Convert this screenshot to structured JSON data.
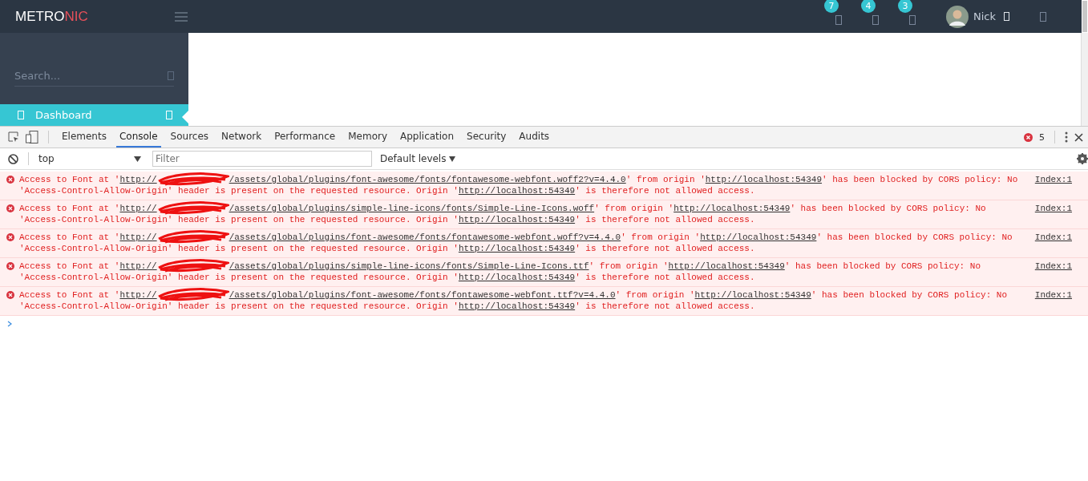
{
  "header": {
    "logo": {
      "main": "METRO",
      "accent": "NIC"
    },
    "badges": [
      "7",
      "4",
      "3"
    ],
    "user": {
      "name": "Nick"
    }
  },
  "sidebar": {
    "search": {
      "placeholder": "Search..."
    },
    "items": [
      {
        "label": "Dashboard",
        "selected": true
      }
    ]
  },
  "devtools": {
    "tabs": [
      {
        "label": "Elements",
        "selected": false
      },
      {
        "label": "Console",
        "selected": true
      },
      {
        "label": "Sources",
        "selected": false
      },
      {
        "label": "Network",
        "selected": false
      },
      {
        "label": "Performance",
        "selected": false
      },
      {
        "label": "Memory",
        "selected": false
      },
      {
        "label": "Application",
        "selected": false
      },
      {
        "label": "Security",
        "selected": false
      },
      {
        "label": "Audits",
        "selected": false
      }
    ],
    "error_count": "5",
    "context": "top",
    "filter": {
      "placeholder": "Filter"
    },
    "levels": "Default levels",
    "messages": [
      {
        "lines": [
          [
            {
              "kind": "text",
              "text": "Access to Font at '"
            },
            {
              "kind": "redacted-link",
              "before": "http://",
              "after": "/assets/global/plugins/font-awesome/fonts/fontawesome-webfont.woff2?v=4.4.0"
            },
            {
              "kind": "text",
              "text": "' from origin '"
            },
            {
              "kind": "link",
              "text": "http://localhost:54349"
            },
            {
              "kind": "text",
              "text": "' has been blocked by CORS policy: No"
            }
          ],
          [
            {
              "kind": "text",
              "text": "'Access-Control-Allow-Origin' header is present on the requested resource. Origin '"
            },
            {
              "kind": "link",
              "text": "http://localhost:54349"
            },
            {
              "kind": "text",
              "text": "' is therefore not allowed access."
            }
          ]
        ],
        "source": "Index:1"
      },
      {
        "lines": [
          [
            {
              "kind": "text",
              "text": "Access to Font at '"
            },
            {
              "kind": "redacted-link",
              "before": "http://",
              "after": "/assets/global/plugins/simple-line-icons/fonts/Simple-Line-Icons.woff"
            },
            {
              "kind": "text",
              "text": "' from origin '"
            },
            {
              "kind": "link",
              "text": "http://localhost:54349"
            },
            {
              "kind": "text",
              "text": "' has been blocked by CORS policy: No"
            }
          ],
          [
            {
              "kind": "text",
              "text": "'Access-Control-Allow-Origin' header is present on the requested resource. Origin '"
            },
            {
              "kind": "link",
              "text": "http://localhost:54349"
            },
            {
              "kind": "text",
              "text": "' is therefore not allowed access."
            }
          ]
        ],
        "source": "Index:1"
      },
      {
        "lines": [
          [
            {
              "kind": "text",
              "text": "Access to Font at '"
            },
            {
              "kind": "redacted-link",
              "before": "http://",
              "after": "/assets/global/plugins/font-awesome/fonts/fontawesome-webfont.woff?v=4.4.0"
            },
            {
              "kind": "text",
              "text": "' from origin '"
            },
            {
              "kind": "link",
              "text": "http://localhost:54349"
            },
            {
              "kind": "text",
              "text": "' has been blocked by CORS policy: No"
            }
          ],
          [
            {
              "kind": "text",
              "text": "'Access-Control-Allow-Origin' header is present on the requested resource. Origin '"
            },
            {
              "kind": "link",
              "text": "http://localhost:54349"
            },
            {
              "kind": "text",
              "text": "' is therefore not allowed access."
            }
          ]
        ],
        "source": "Index:1"
      },
      {
        "lines": [
          [
            {
              "kind": "text",
              "text": "Access to Font at '"
            },
            {
              "kind": "redacted-link",
              "before": "http://",
              "after": "/assets/global/plugins/simple-line-icons/fonts/Simple-Line-Icons.ttf"
            },
            {
              "kind": "text",
              "text": "' from origin '"
            },
            {
              "kind": "link",
              "text": "http://localhost:54349"
            },
            {
              "kind": "text",
              "text": "' has been blocked by CORS policy: No"
            }
          ],
          [
            {
              "kind": "text",
              "text": "'Access-Control-Allow-Origin' header is present on the requested resource. Origin '"
            },
            {
              "kind": "link",
              "text": "http://localhost:54349"
            },
            {
              "kind": "text",
              "text": "' is therefore not allowed access."
            }
          ]
        ],
        "source": "Index:1"
      },
      {
        "lines": [
          [
            {
              "kind": "text",
              "text": "Access to Font at '"
            },
            {
              "kind": "redacted-link",
              "before": "http://",
              "after": "/assets/global/plugins/font-awesome/fonts/fontawesome-webfont.ttf?v=4.4.0"
            },
            {
              "kind": "text",
              "text": "' from origin '"
            },
            {
              "kind": "link",
              "text": "http://localhost:54349"
            },
            {
              "kind": "text",
              "text": "' has been blocked by CORS policy: No"
            }
          ],
          [
            {
              "kind": "text",
              "text": "'Access-Control-Allow-Origin' header is present on the requested resource. Origin '"
            },
            {
              "kind": "link",
              "text": "http://localhost:54349"
            },
            {
              "kind": "text",
              "text": "' is therefore not allowed access."
            }
          ]
        ],
        "source": "Index:1"
      }
    ]
  }
}
